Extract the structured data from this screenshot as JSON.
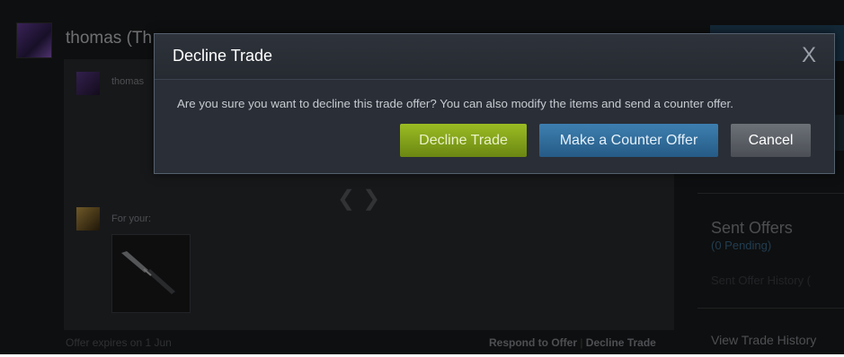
{
  "background": {
    "trader_name": "thomas (Th",
    "mini_name": "thomas",
    "for_your_label": "For your:",
    "offer_expires": "Offer expires on 1 Jun",
    "respond_link": "Respond to Offer",
    "decline_link": "Decline Trade",
    "sent_offers_title": "Sent Offers",
    "sent_offers_pending": "(0 Pending)",
    "sent_offer_history": "Sent Offer History (",
    "view_trade_history": "View Trade History"
  },
  "dialog": {
    "title": "Decline Trade",
    "close_glyph": "X",
    "message": "Are you sure you want to decline this trade offer? You can also modify the items and send a counter offer.",
    "decline_label": "Decline Trade",
    "counter_label": "Make a Counter Offer",
    "cancel_label": "Cancel"
  },
  "colors": {
    "decline_button": "#8aaa1c",
    "counter_button": "#2f6e9e",
    "cancel_button": "#5d6167",
    "dialog_bg": "#2a2e36"
  },
  "icons": {
    "item": "knife-icon",
    "arrows": "trade-arrows-icon"
  }
}
